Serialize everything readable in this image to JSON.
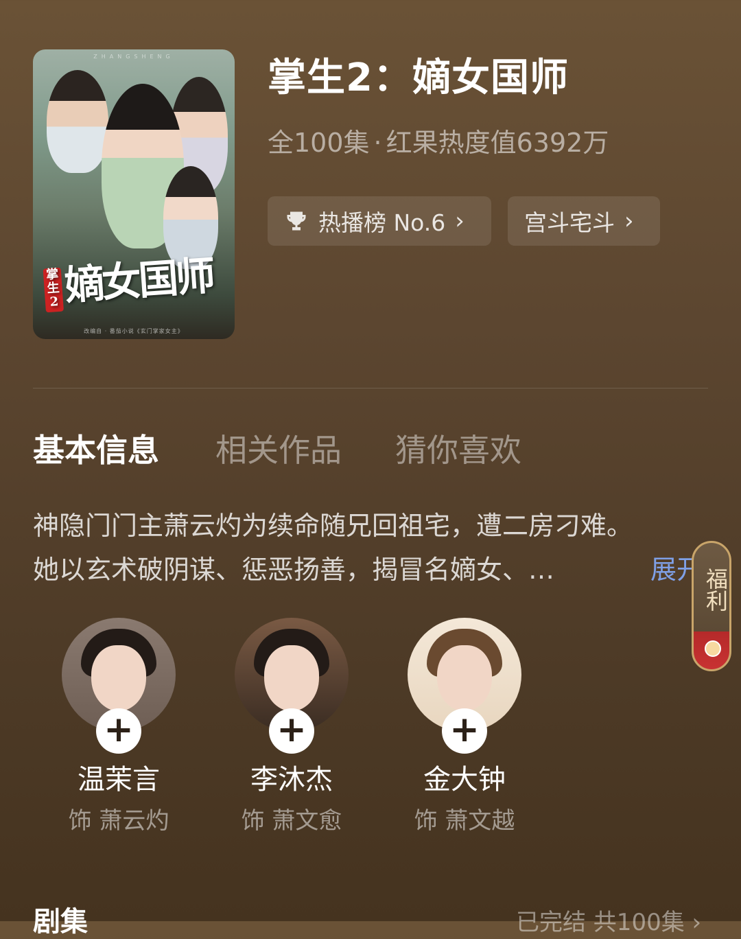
{
  "drama": {
    "title": "掌生2：嫡女国师",
    "episodes": "全100集",
    "separator": "·",
    "popularity": "红果热度值6392万"
  },
  "chips": {
    "rank_label": "热播榜 No.6",
    "genre_label": "宫斗宅斗",
    "chevron": "›",
    "trophy_icon": "trophy-icon"
  },
  "poster": {
    "title_art": "嫡女国师",
    "seal_text": "掌生2",
    "top_text": "ZHANGSHENG",
    "credit": "改编自 · 番茄小说《玄门掌家女主》"
  },
  "tabs": [
    "基本信息",
    "相关作品",
    "猜你喜欢"
  ],
  "synopsis": {
    "line1": "神隐门门主萧云灼为续命随兄回祖宅，遭二房刁难。",
    "line2": "她以玄术破阴谋、惩恶扬善，揭冒名嫡女、…",
    "expand": "展开"
  },
  "floating": {
    "text": "福利"
  },
  "cast": [
    {
      "name": "温茉言",
      "role": "饰  萧云灼"
    },
    {
      "name": "李沐杰",
      "role": "饰  萧文愈"
    },
    {
      "name": "金大钟",
      "role": "饰  萧文越"
    }
  ],
  "add_symbol": "+",
  "bottom": {
    "left": "剧集",
    "right": "已完结 共100集 ›"
  }
}
